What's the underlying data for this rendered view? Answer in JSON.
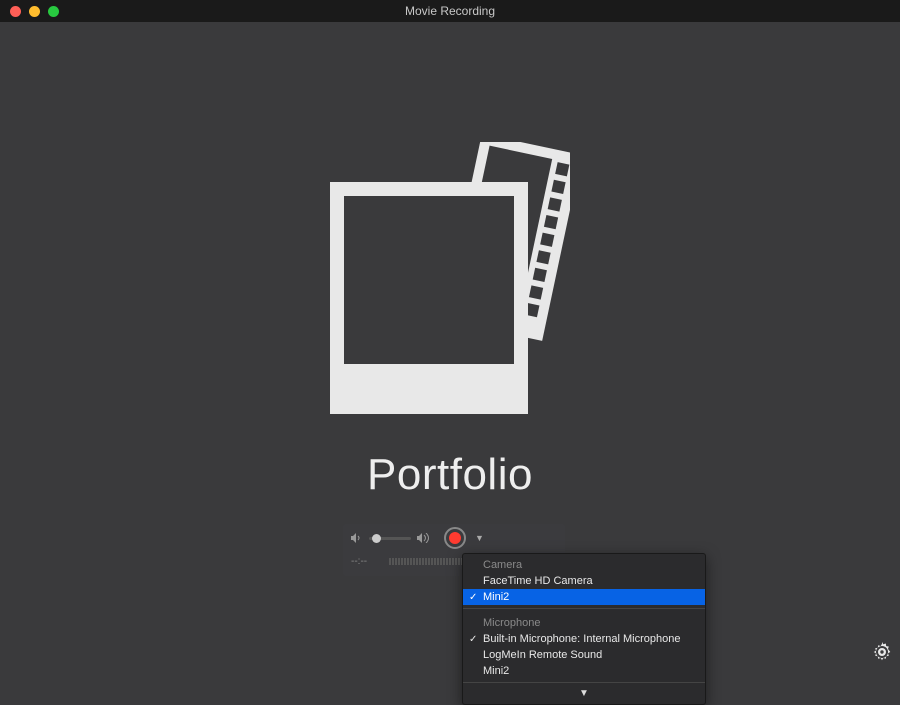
{
  "window": {
    "title": "Movie Recording"
  },
  "placeholder": {
    "title": "Portfolio"
  },
  "controls": {
    "timecode": "--:--"
  },
  "menu": {
    "camera_header": "Camera",
    "camera_options": [
      {
        "label": "FaceTime HD Camera",
        "checked": false,
        "selected": false
      },
      {
        "label": "Mini2",
        "checked": true,
        "selected": true
      }
    ],
    "microphone_header": "Microphone",
    "microphone_options": [
      {
        "label": "Built-in Microphone: Internal Microphone",
        "checked": true,
        "selected": false
      },
      {
        "label": "LogMeIn Remote Sound",
        "checked": false,
        "selected": false
      },
      {
        "label": "Mini2",
        "checked": false,
        "selected": false
      }
    ]
  }
}
